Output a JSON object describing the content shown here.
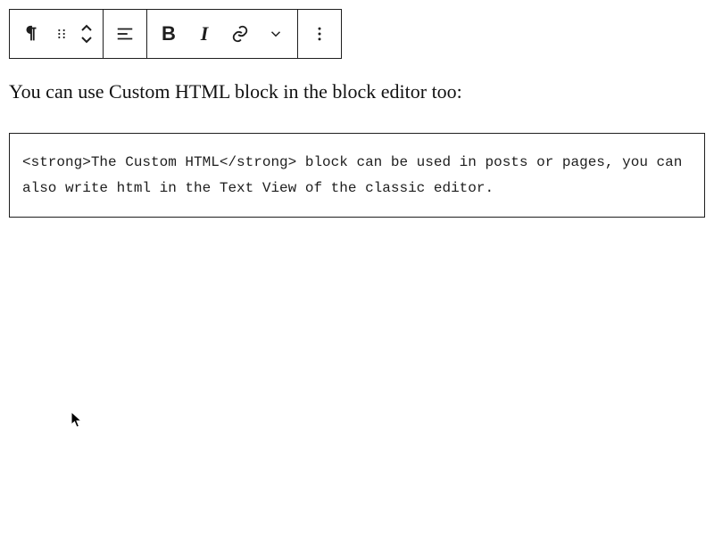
{
  "toolbar": {
    "bold_label": "B",
    "italic_label": "I"
  },
  "paragraph": {
    "text": "You can use Custom HTML block in the block editor too:"
  },
  "html_block": {
    "content": "<strong>The Custom HTML</strong> block can be used in posts or pages, you can also write html in the Text View of the classic editor."
  }
}
